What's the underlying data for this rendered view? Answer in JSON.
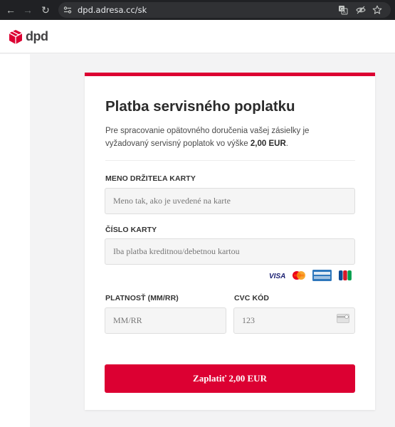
{
  "browser": {
    "url": "dpd.adresa.cc/sk",
    "icons": [
      "back-icon",
      "forward-icon",
      "reload-icon",
      "site-info-icon",
      "translate-icon",
      "eye-slash-icon",
      "star-icon"
    ]
  },
  "header": {
    "logo_text": "dpd",
    "logo_icon": "dpd-cube-icon"
  },
  "colors": {
    "brand_red": "#dc0032",
    "chrome_dark": "#202124"
  },
  "card": {
    "title": "Platba servisného poplatku",
    "description_text": "Pre spracovanie opätovného doručenia vašej zásielky je vyžadovaný servisný poplatok vo výške ",
    "description_amount": "2,00 EUR",
    "description_end": ".",
    "name_label": "MENO DRŽITEĽA KARTY",
    "name_placeholder": "Meno tak, ako je uvedené na karte",
    "card_label": "ČÍSLO KARTY",
    "card_placeholder": "Iba platba kreditnou/debetnou kartou",
    "card_brands": [
      "VISA",
      "Mastercard",
      "American Express",
      "JCB"
    ],
    "expiry_label": "PLATNOSŤ (MM/RR)",
    "expiry_placeholder": "MM/RR",
    "cvc_label": "CVC KÓD",
    "cvc_placeholder": "123",
    "pay_button": "Zaplatiť 2,00 EUR"
  }
}
